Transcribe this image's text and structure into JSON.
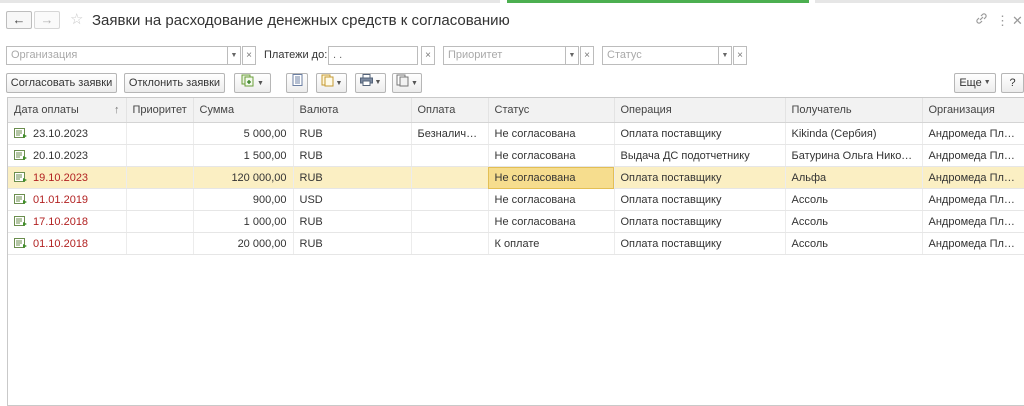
{
  "page": {
    "title": "Заявки на расходование денежных средств к согласованию"
  },
  "filters": {
    "organization_placeholder": "Организация",
    "payments_label": "Платежи до:",
    "date_value": " .  .",
    "priority_placeholder": "Приоритет",
    "status_placeholder": "Статус"
  },
  "toolbar": {
    "approve_label": "Согласовать заявки",
    "reject_label": "Отклонить заявки",
    "more_label": "Еще"
  },
  "table": {
    "columns": [
      "Дата оплаты",
      "Приоритет",
      "Сумма",
      "Валюта",
      "Оплата",
      "Статус",
      "Операция",
      "Получатель",
      "Организация"
    ],
    "rows": [
      {
        "date": "23.10.2023",
        "priority": "",
        "amount": "5 000,00",
        "currency": "RUB",
        "payment": "Безналичная",
        "status": "Не согласована",
        "operation": "Оплата поставщику",
        "recipient": "Kikinda (Сербия)",
        "org": "Андромеда Плюс",
        "overdue": false
      },
      {
        "date": "20.10.2023",
        "priority": "",
        "amount": "1 500,00",
        "currency": "RUB",
        "payment": "",
        "status": "Не согласована",
        "operation": "Выдача ДС подотчетнику",
        "recipient": "Батурина Ольга Никола...",
        "org": "Андромеда Плюс",
        "overdue": false
      },
      {
        "date": "19.10.2023",
        "priority": "",
        "amount": "120 000,00",
        "currency": "RUB",
        "payment": "",
        "status": "Не согласована",
        "operation": "Оплата поставщику",
        "recipient": "Альфа",
        "org": "Андромеда Плюс",
        "overdue": true,
        "selected": true
      },
      {
        "date": "01.01.2019",
        "priority": "",
        "amount": "900,00",
        "currency": "USD",
        "payment": "",
        "status": "Не согласована",
        "operation": "Оплата поставщику",
        "recipient": "Ассоль",
        "org": "Андромеда Плюс",
        "overdue": true
      },
      {
        "date": "17.10.2018",
        "priority": "",
        "amount": "1 000,00",
        "currency": "RUB",
        "payment": "",
        "status": "Не согласована",
        "operation": "Оплата поставщику",
        "recipient": "Ассоль",
        "org": "Андромеда Плюс",
        "overdue": true
      },
      {
        "date": "01.10.2018",
        "priority": "",
        "amount": "20 000,00",
        "currency": "RUB",
        "payment": "",
        "status": "К оплате",
        "operation": "Оплата поставщику",
        "recipient": "Ассоль",
        "org": "Андромеда Плюс",
        "overdue": true
      }
    ]
  },
  "colors": {
    "overdue": "#b22222",
    "selected_row": "#fbefc3",
    "selected_cell": "#f6dd8e",
    "active_tab": "#4caf50"
  }
}
